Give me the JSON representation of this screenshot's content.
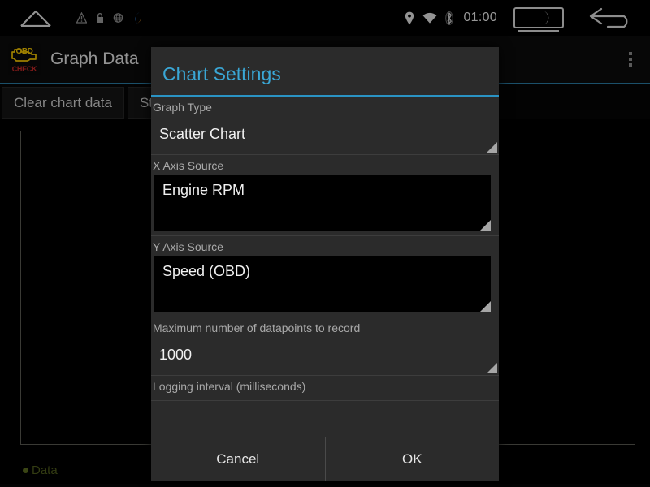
{
  "statusbar": {
    "home_icon": "home-icon",
    "left_icons": [
      "warning-triangle-icon",
      "lock-icon",
      "globe-icon",
      "app-badge-icon"
    ],
    "location_icon": "location-pin-icon",
    "wifi_icon": "wifi-icon",
    "bluetooth_icon": "bluetooth-icon",
    "clock": "01:00",
    "night_mode_icon": "night-mode-widget-icon",
    "back_icon": "back-arrow-icon"
  },
  "app": {
    "icon_label_top": "OBD",
    "icon_label_bottom": "CHECK",
    "title": "Graph Data",
    "overflow_icon": "overflow-menu-icon",
    "buttons": [
      {
        "label": "Clear chart data"
      },
      {
        "label": "Start logging"
      }
    ],
    "legend": [
      {
        "label": "Data",
        "color": "#5a6a1f"
      }
    ]
  },
  "dialog": {
    "title": "Chart Settings",
    "accent_color": "#2a93c4",
    "fields": [
      {
        "label": "Graph Type",
        "value": "Scatter Chart",
        "style": "plain"
      },
      {
        "label": "X Axis Source",
        "value": "Engine RPM",
        "style": "dark"
      },
      {
        "label": "Y Axis Source",
        "value": "Speed (OBD)",
        "style": "dark"
      },
      {
        "label": "Maximum number of datapoints to record",
        "value": "1000",
        "style": "plain"
      },
      {
        "label": "Logging interval (milliseconds)",
        "value": "",
        "style": "plain"
      }
    ],
    "cancel_label": "Cancel",
    "ok_label": "OK"
  }
}
